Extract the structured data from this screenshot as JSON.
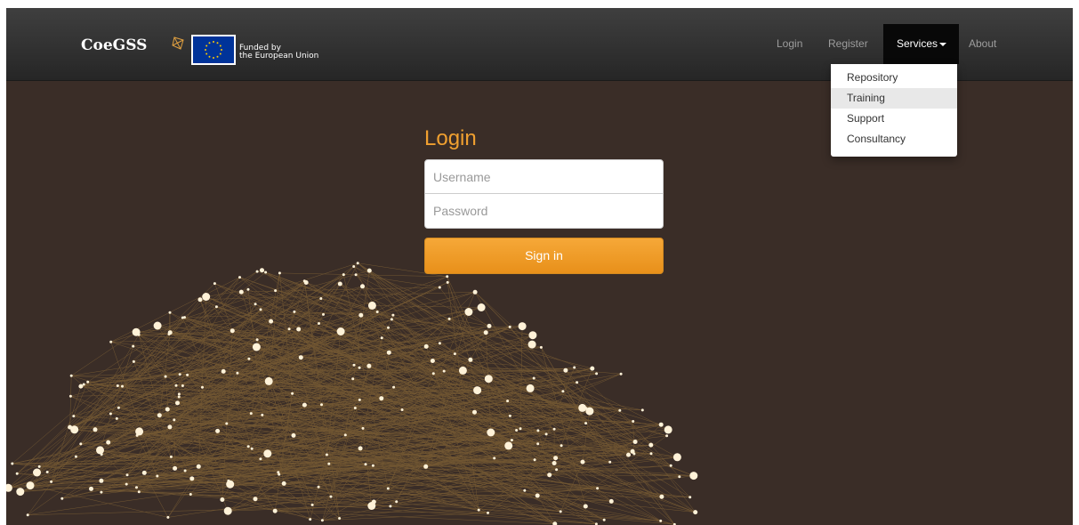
{
  "header": {
    "brand": "CoeGSS",
    "eu_text_line1": "Funded by",
    "eu_text_line2": "the European Union",
    "nav": {
      "login": "Login",
      "register": "Register",
      "services": "Services",
      "about": "About"
    }
  },
  "services_menu": {
    "items": [
      "Repository",
      "Training",
      "Support",
      "Consultancy"
    ],
    "highlighted": "Training"
  },
  "login_form": {
    "title": "Login",
    "username_placeholder": "Username",
    "password_placeholder": "Password",
    "submit_label": "Sign in"
  },
  "colors": {
    "accent": "#f0a030",
    "background": "#3a2d27",
    "network_line": "#a07a3c",
    "network_node": "#fff2d8"
  }
}
